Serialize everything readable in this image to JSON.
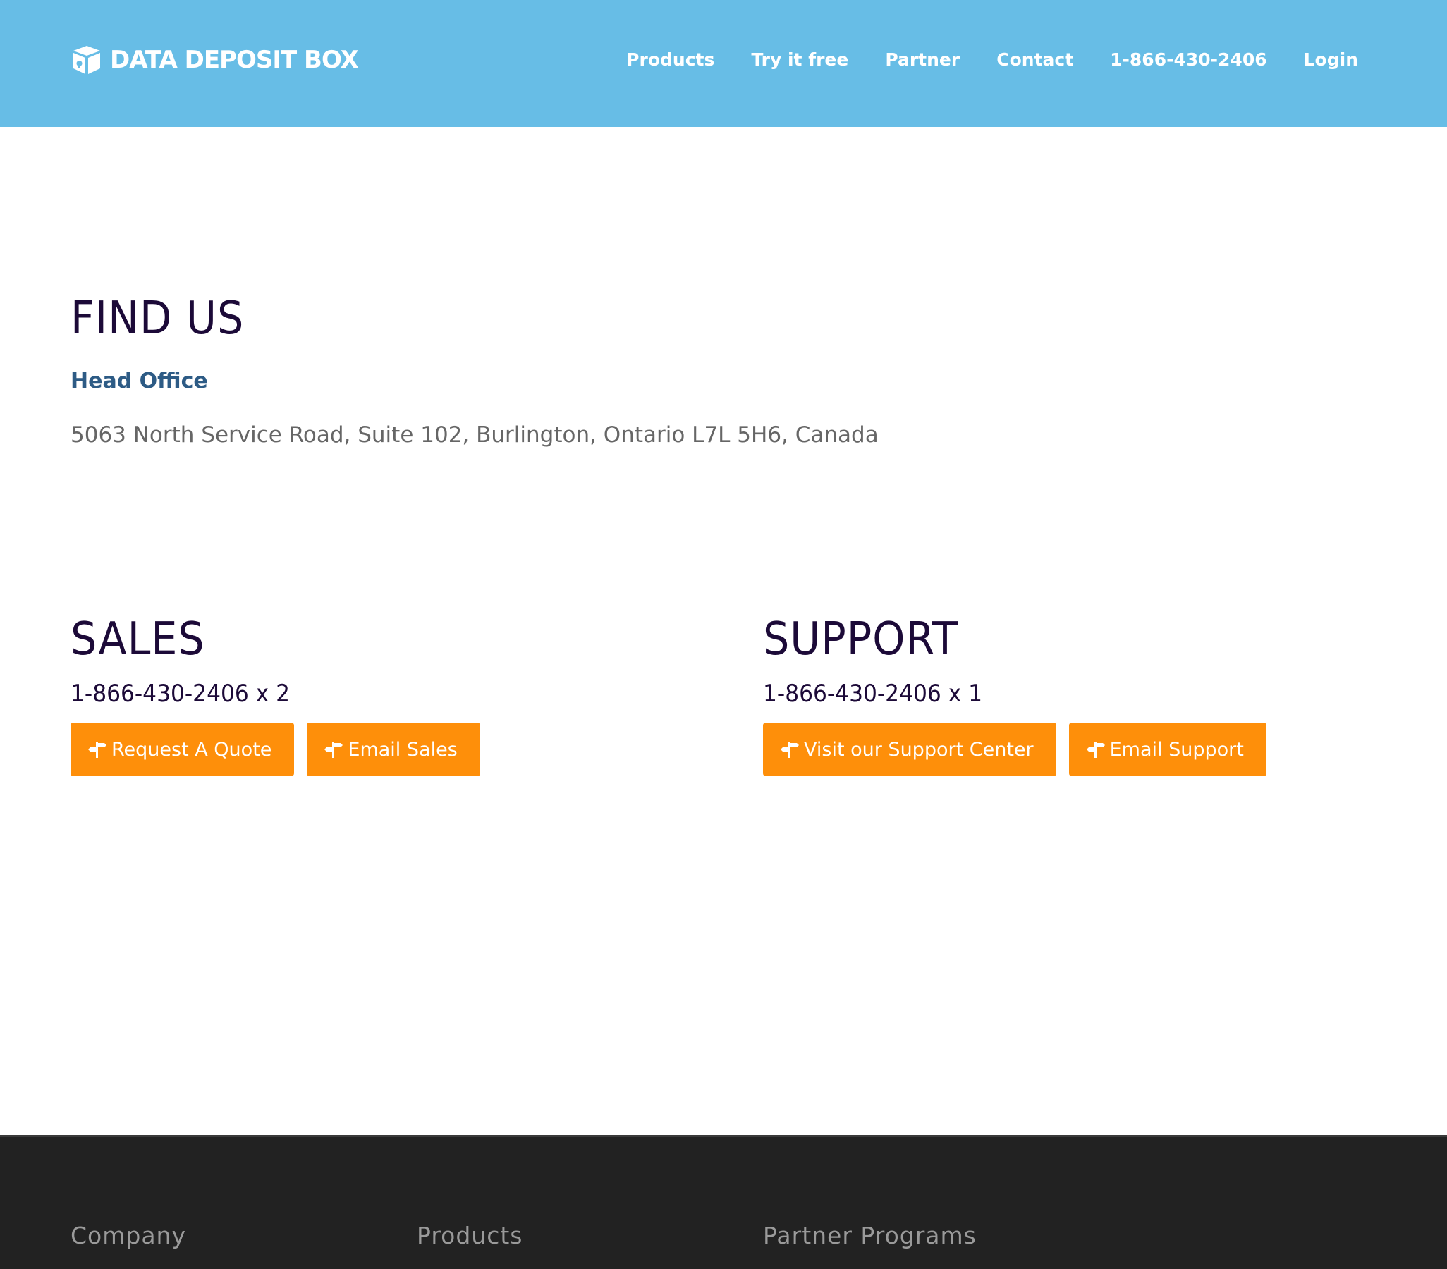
{
  "header": {
    "logo_text": "DATA DEPOSIT BOX",
    "nav": [
      {
        "label": "Products"
      },
      {
        "label": "Try it free"
      },
      {
        "label": "Partner"
      },
      {
        "label": "Contact"
      },
      {
        "label": "1-866-430-2406"
      },
      {
        "label": "Login"
      }
    ]
  },
  "find_us": {
    "title": "FIND US",
    "office_label": "Head Office",
    "address": "5063 North Service Road, Suite 102, Burlington, Ontario L7L 5H6, Canada"
  },
  "sales": {
    "title": "SALES",
    "phone": "1-866-430-2406 x 2",
    "buttons": [
      {
        "label": "Request A Quote",
        "icon": "signpost-icon"
      },
      {
        "label": "Email Sales",
        "icon": "signpost-icon"
      }
    ]
  },
  "support": {
    "title": "SUPPORT",
    "phone": "1-866-430-2406 x 1",
    "buttons": [
      {
        "label": "Visit our Support Center",
        "icon": "signpost-icon"
      },
      {
        "label": "Email Support",
        "icon": "signpost-icon"
      }
    ]
  },
  "footer": {
    "headings": [
      "Company",
      "Products",
      "Partner Programs"
    ]
  },
  "colors": {
    "header_bg": "#67bde6",
    "heading": "#1c0a38",
    "office_label": "#2d5b85",
    "button": "#fe8f0a",
    "footer_bg": "#222222"
  }
}
